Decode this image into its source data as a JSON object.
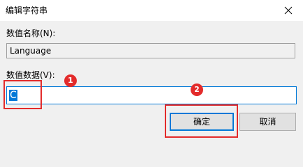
{
  "window": {
    "title": "编辑字符串"
  },
  "name_label": "数值名称(N):",
  "name_value": "Language",
  "data_label": "数值数据(V):",
  "data_value": "C",
  "buttons": {
    "ok": "确定",
    "cancel": "取消"
  },
  "annotations": [
    {
      "number": "1"
    },
    {
      "number": "2"
    }
  ],
  "colors": {
    "accent": "#0078d7",
    "annotation": "#e32b2b"
  },
  "icons": {
    "close": "close-icon"
  }
}
